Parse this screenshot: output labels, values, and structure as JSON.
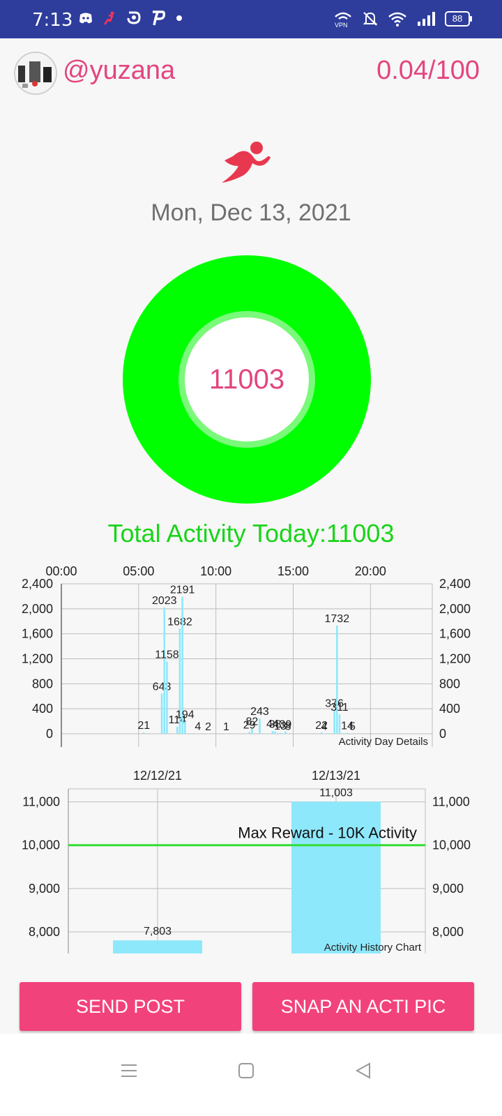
{
  "status_bar": {
    "time": "7:13",
    "battery": "88",
    "vpn_label": "VPN",
    "app_icons": [
      "discord-icon",
      "runner-icon",
      "app-icon",
      "p-icon",
      "dot-icon"
    ],
    "system_icons": [
      "vpn-icon",
      "mute-bell-icon",
      "wifi-icon",
      "signal-icon",
      "battery-icon"
    ]
  },
  "header": {
    "username": "@yuzana",
    "score": "0.04/100"
  },
  "date": "Mon, Dec 13, 2021",
  "ring": {
    "value": "11003",
    "ring_color": "#00ff00",
    "text_color": "#e2457f"
  },
  "total_activity": "Total Activity Today:11003",
  "chart_data": [
    {
      "type": "bar",
      "title": "Activity Day Details",
      "x_ticks": [
        "00:00",
        "05:00",
        "10:00",
        "15:00",
        "20:00"
      ],
      "y_ticks": [
        "2,400",
        "2,000",
        "1,600",
        "1,200",
        "800",
        "400",
        "0"
      ],
      "ylim": [
        0,
        2400
      ],
      "grid": true,
      "bar_color": "#8ee8fb",
      "series": [
        {
          "time": "05:20",
          "value": 21
        },
        {
          "time": "06:30",
          "value": 643
        },
        {
          "time": "06:40",
          "value": 2023
        },
        {
          "time": "06:50",
          "value": 1158
        },
        {
          "time": "07:30",
          "value": 114
        },
        {
          "time": "07:40",
          "value": 1682
        },
        {
          "time": "07:50",
          "value": 2191
        },
        {
          "time": "08:00",
          "value": 194
        },
        {
          "time": "08:50",
          "value": 4
        },
        {
          "time": "09:30",
          "value": 2
        },
        {
          "time": "10:40",
          "value": 1
        },
        {
          "time": "12:10",
          "value": 29
        },
        {
          "time": "12:20",
          "value": 82
        },
        {
          "time": "12:50",
          "value": 243
        },
        {
          "time": "13:40",
          "value": 44
        },
        {
          "time": "13:50",
          "value": 38
        },
        {
          "time": "14:10",
          "value": 13
        },
        {
          "time": "14:30",
          "value": 39
        },
        {
          "time": "14:40",
          "value": 8
        },
        {
          "time": "16:50",
          "value": 22
        },
        {
          "time": "17:00",
          "value": 4
        },
        {
          "time": "17:40",
          "value": 376
        },
        {
          "time": "17:50",
          "value": 1732
        },
        {
          "time": "18:00",
          "value": 311
        },
        {
          "time": "18:30",
          "value": 14
        },
        {
          "time": "18:50",
          "value": 5
        }
      ]
    },
    {
      "type": "bar",
      "title": "Activity History Chart",
      "categories": [
        "12/12/21",
        "12/13/21"
      ],
      "values": [
        7803,
        11003
      ],
      "value_labels": [
        "7,803",
        "11,003"
      ],
      "y_ticks": [
        "11,000",
        "10,000",
        "9,000",
        "8,000"
      ],
      "ylim": [
        7500,
        11300
      ],
      "grid": true,
      "bar_color": "#8ee8fb",
      "reference_line": {
        "value": 10000,
        "label": "Max Reward - 10K Activity",
        "color": "#33dd33"
      }
    }
  ],
  "buttons": {
    "send_post": "SEND POST",
    "snap": "SNAP AN ACTI PIC"
  },
  "navbar": {
    "items": [
      "menu-icon",
      "home-square-icon",
      "back-triangle-icon"
    ]
  }
}
